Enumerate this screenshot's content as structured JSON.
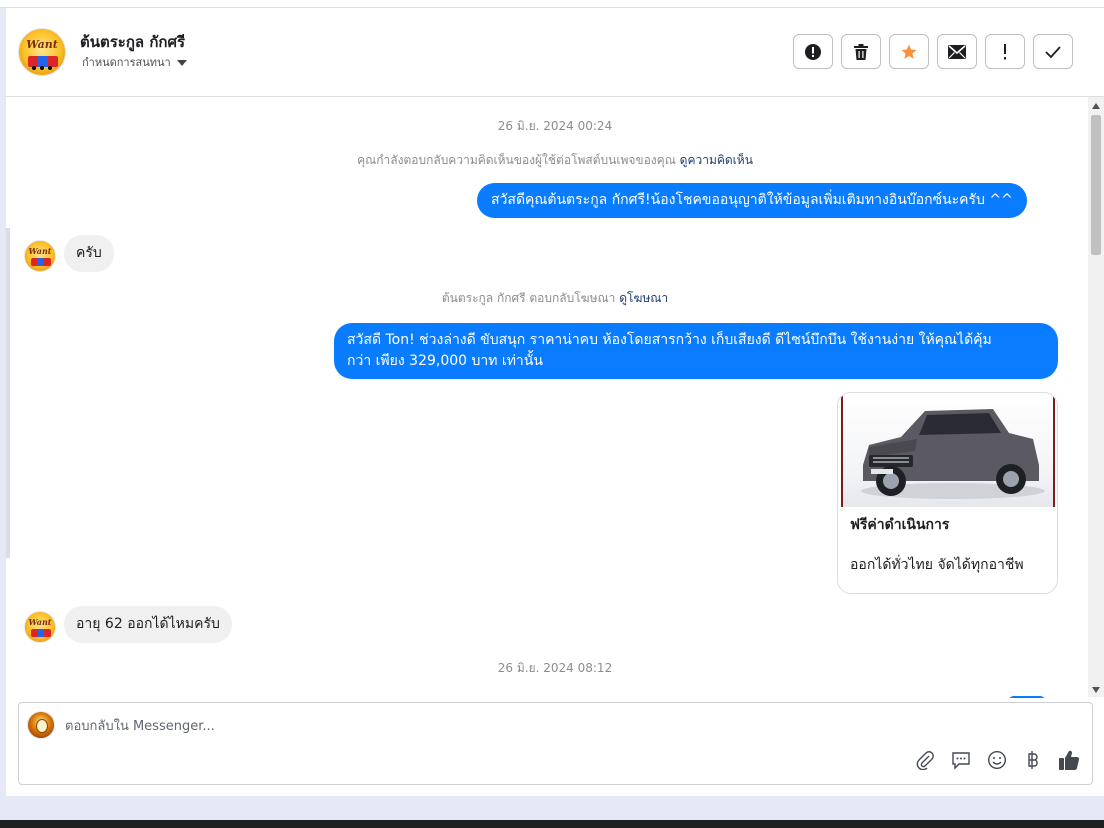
{
  "header": {
    "contact_name": "ต้นตระกูล กักศรี",
    "assign_label": "กำหนดการสนทนา",
    "avatar_logo_text": "Want",
    "actions": [
      {
        "icon": "alert-circle-icon",
        "name": "spam-button"
      },
      {
        "icon": "trash-icon",
        "name": "delete-button"
      },
      {
        "icon": "star-icon",
        "name": "star-button",
        "color": "#f7923a"
      },
      {
        "icon": "envelope-icon",
        "name": "mark-unread-button"
      },
      {
        "icon": "exclamation-icon",
        "name": "follow-up-button"
      },
      {
        "icon": "check-icon",
        "name": "done-button"
      }
    ]
  },
  "thread": {
    "timestamp_1": "26 มิ.ย. 2024 00:24",
    "notice_1": {
      "text": "คุณกำลังตอบกลับความคิดเห็นของผู้ใช้ต่อโพสต์บนเพจของคุณ",
      "link": "ดูความคิดเห็น"
    },
    "msg_out_1": "สวัสดีคุณต้นตระกูล กักศรี!น้องโชคขออนุญาติให้ข้อมูลเพิ่มเติมทางอินบ๊อกซ์นะครับ ^^",
    "msg_in_1": "ครับ",
    "notice_2": {
      "text": "ต้นตระกูล กักศรี ตอบกลับโฆษณา",
      "link": "ดูโฆษณา"
    },
    "msg_out_2_line1": "สวัสดี Ton! ช่วงล่างดี ขับสนุก ราคาน่าคบ ห้องโดยสารกว้าง เก็บเสียงดี ดีไซน์บึกบึน ใช้งานง่าย ให้คุณได้คุ้ม",
    "msg_out_2_line2": "กว่า เพียง 329,000 บาท เท่านั้น",
    "card": {
      "title": "ฟรีค่าดำเนินการ",
      "description": "ออกได้ทั่วไทย จัดได้ทุกอาชีพ",
      "image": "grey-pickup-truck"
    },
    "msg_in_2": "อายุ 62 ออกได้ไหมครับ",
    "timestamp_2": "26 มิ.ย. 2024 08:12"
  },
  "composer": {
    "placeholder": "ตอบกลับใน Messenger...",
    "tools": [
      "paperclip-icon",
      "saved-reply-icon",
      "emoji-icon",
      "baht-icon",
      "thumbs-up-icon"
    ]
  },
  "colors": {
    "bubble_out": "#0a7cff",
    "bubble_in": "#f0f0f0",
    "star": "#f7923a"
  }
}
